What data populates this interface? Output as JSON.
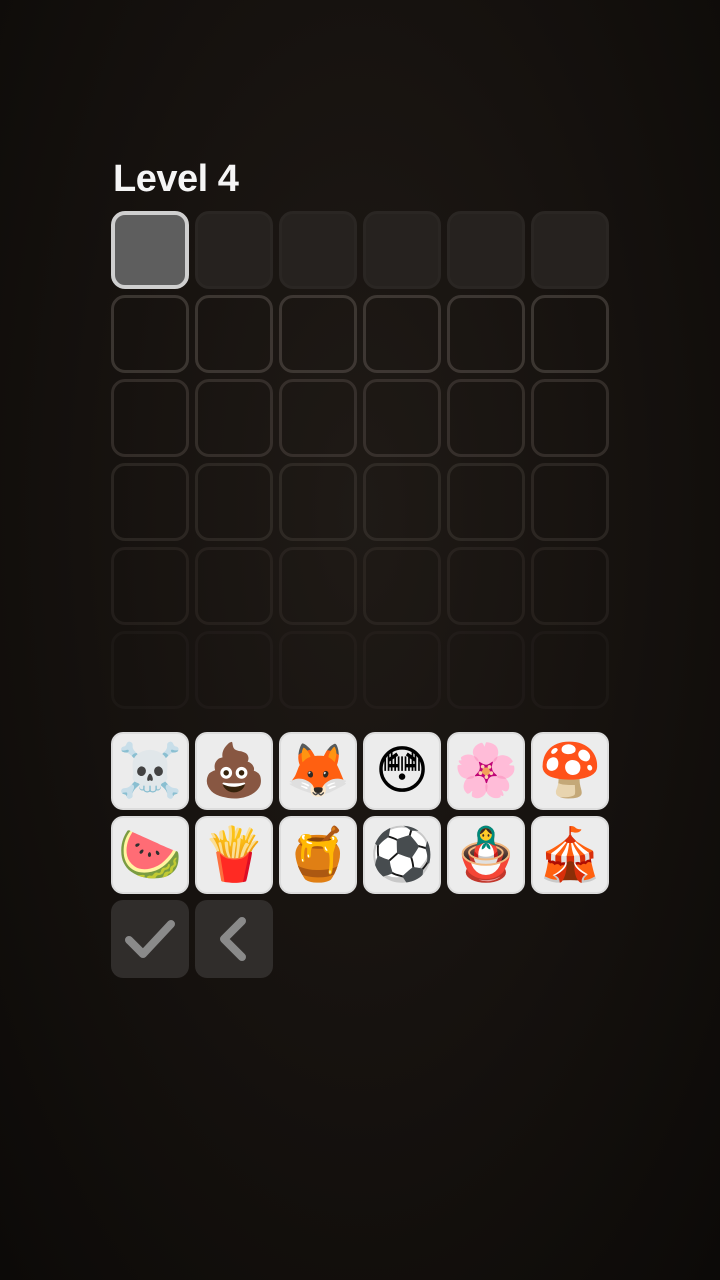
{
  "level": {
    "title": "Level 4"
  },
  "board": {
    "rows": 6,
    "cols": 6,
    "active_row": 0,
    "active_col": 0
  },
  "keyboard": {
    "keys": [
      {
        "emoji": "☠️",
        "icon": "skull-and-crossbones-icon"
      },
      {
        "emoji": "💩",
        "icon": "pile-of-poo-icon"
      },
      {
        "emoji": "🦊",
        "icon": "fox-icon"
      },
      {
        "emoji": "😳",
        "icon": "flushed-face-icon"
      },
      {
        "emoji": "🌸",
        "icon": "cherry-blossom-icon"
      },
      {
        "emoji": "🍄",
        "icon": "mushroom-icon"
      },
      {
        "emoji": "🍉",
        "icon": "watermelon-icon"
      },
      {
        "emoji": "🍟",
        "icon": "french-fries-icon"
      },
      {
        "emoji": "🍯",
        "icon": "honey-pot-icon"
      },
      {
        "emoji": "⚽",
        "icon": "soccer-ball-icon"
      },
      {
        "emoji": "🪆",
        "icon": "nesting-dolls-icon"
      },
      {
        "emoji": "🎪",
        "icon": "circus-tent-icon"
      }
    ]
  },
  "controls": {
    "submit_icon": "checkmark-icon",
    "back_icon": "chevron-left-icon"
  },
  "colors": {
    "background": "#15110e",
    "title": "#f5f5f5",
    "active_cell": "#5e5e5e",
    "active_border": "#cfcfcf",
    "key_bg": "#ececec",
    "control_bg": "#302d2b",
    "control_icon": "#8a8a8a"
  }
}
